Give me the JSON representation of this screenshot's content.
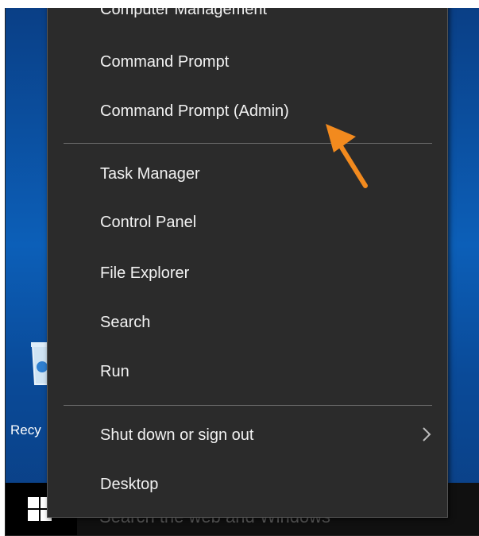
{
  "menu": {
    "items_top": [
      {
        "label": "Computer Management"
      },
      {
        "label": "Command Prompt"
      },
      {
        "label": "Command Prompt (Admin)"
      }
    ],
    "items_mid": [
      {
        "label": "Task Manager"
      },
      {
        "label": "Control Panel"
      },
      {
        "label": "File Explorer"
      },
      {
        "label": "Search"
      },
      {
        "label": "Run"
      }
    ],
    "items_bottom": [
      {
        "label": "Shut down or sign out",
        "has_submenu": true
      },
      {
        "label": "Desktop"
      }
    ]
  },
  "desktop": {
    "recycle_bin_label": "Recy"
  },
  "taskbar": {
    "search_placeholder": "Search the web and Windows"
  },
  "annotation": {
    "arrow_color": "#f28a1e",
    "points_to": "Command Prompt (Admin)"
  },
  "colors": {
    "menu_bg": "#2b2b2b",
    "desktop_blue": "#0c5fb8",
    "taskbar": "#101010"
  }
}
